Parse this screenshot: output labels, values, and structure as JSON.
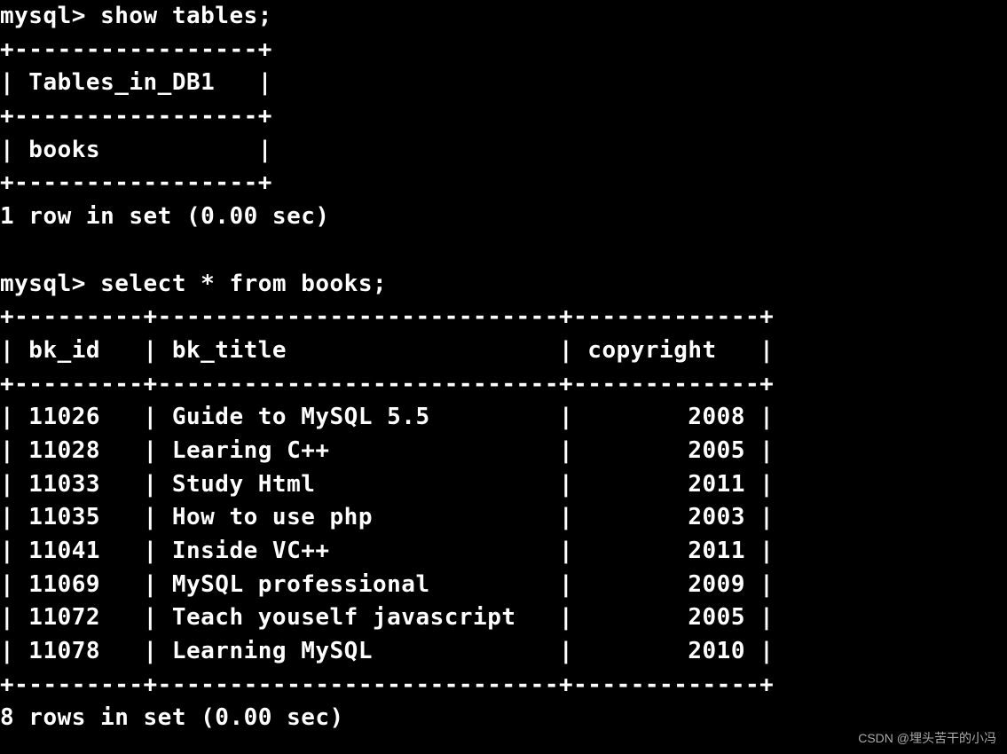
{
  "session": {
    "prompt": "mysql>",
    "blocks": [
      {
        "command": "show tables;",
        "table": {
          "columns": [
            "Tables_in_DB1"
          ],
          "widths": [
            15
          ],
          "aligns": [
            "left"
          ],
          "rows": [
            [
              "books"
            ]
          ]
        },
        "status": "1 row in set (0.00 sec)"
      },
      {
        "command": "select * from books;",
        "table": {
          "columns": [
            "bk_id",
            "bk_title",
            "copyright"
          ],
          "widths": [
            7,
            26,
            11
          ],
          "aligns": [
            "left",
            "left",
            "right"
          ],
          "rows": [
            [
              "11026",
              "Guide to MySQL 5.5",
              "2008"
            ],
            [
              "11028",
              "Learing C++",
              "2005"
            ],
            [
              "11033",
              "Study Html",
              "2011"
            ],
            [
              "11035",
              "How to use php",
              "2003"
            ],
            [
              "11041",
              "Inside VC++",
              "2011"
            ],
            [
              "11069",
              "MySQL professional",
              "2009"
            ],
            [
              "11072",
              "Teach youself javascript",
              "2005"
            ],
            [
              "11078",
              "Learning MySQL",
              "2010"
            ]
          ]
        },
        "status": "8 rows in set (0.00 sec)"
      }
    ]
  },
  "watermark": "CSDN @埋头苦干的小冯"
}
